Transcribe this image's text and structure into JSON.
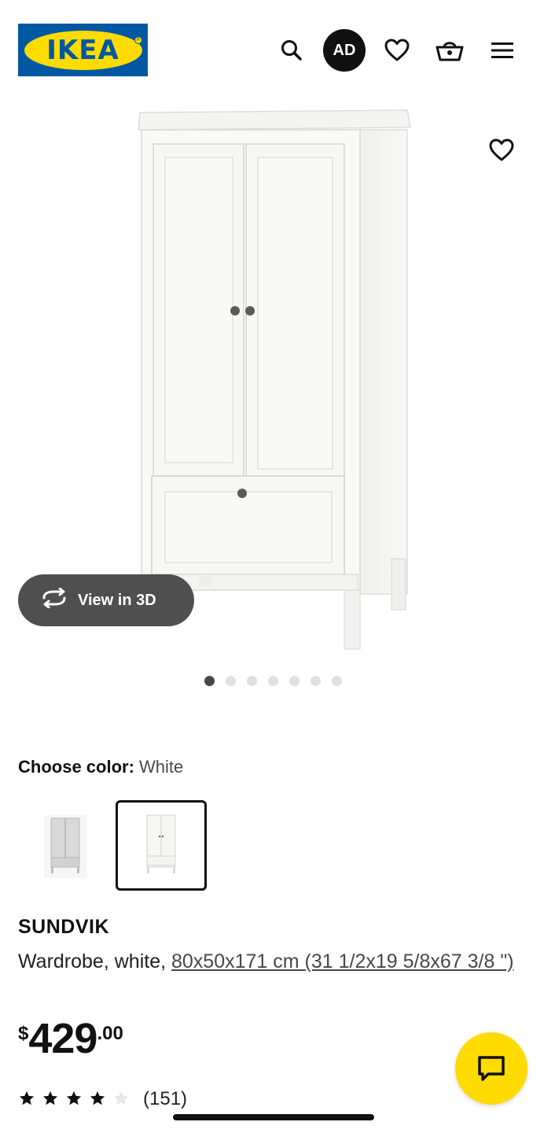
{
  "header": {
    "logo_text": "IKEA",
    "avatar_initials": "AD",
    "icons": [
      "search-icon",
      "heart-icon",
      "basket-icon",
      "menu-icon"
    ]
  },
  "gallery": {
    "view_3d_label": "View in 3D",
    "dots_total": 7,
    "dots_active": 1
  },
  "color": {
    "label": "Choose color:",
    "value": "White",
    "options": [
      "grey",
      "white"
    ],
    "selected": "white"
  },
  "product": {
    "name": "SUNDVIK",
    "type_text": "Wardrobe, white, ",
    "dimensions": "80x50x171 cm (31 1/2x19 5/8x67 3/8 \")"
  },
  "price": {
    "currency": "$",
    "integer": "429",
    "decimal": ".00"
  },
  "rating": {
    "stars": 4,
    "max": 5,
    "reviews": "(151)"
  },
  "colors": {
    "ikea_blue": "#0058a3",
    "ikea_yellow": "#ffdb00",
    "pill_gray": "#4f4f4f"
  }
}
